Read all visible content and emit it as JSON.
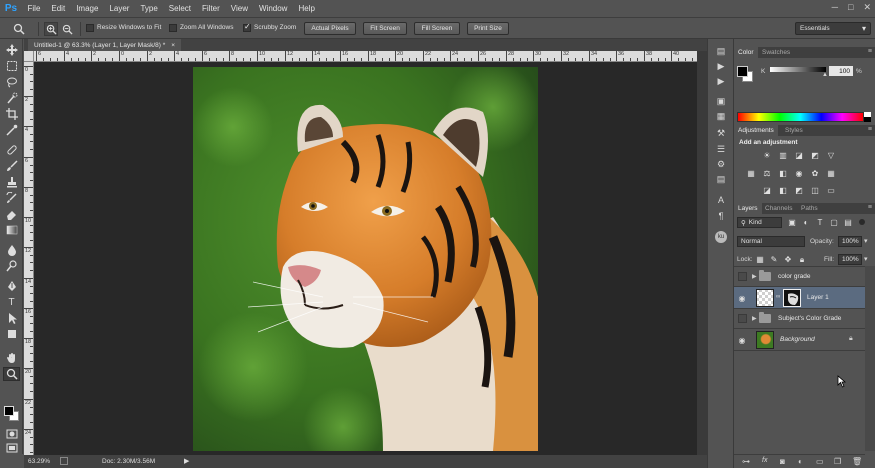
{
  "app": {
    "logo": "Ps"
  },
  "menu": [
    "File",
    "Edit",
    "Image",
    "Layer",
    "Type",
    "Select",
    "Filter",
    "View",
    "Window",
    "Help"
  ],
  "window_controls": [
    "─",
    "□",
    "✕"
  ],
  "options_bar": {
    "resize_windows_label": "Resize Windows to Fit",
    "zoom_all_label": "Zoom All Windows",
    "scrubby_zoom_label": "Scrubby Zoom",
    "actual_pixels_label": "Actual Pixels",
    "fit_screen_label": "Fit Screen",
    "fill_screen_label": "Fill Screen",
    "print_size_label": "Print Size",
    "workspace": "Essentials",
    "resize_checked": false,
    "zoom_all_checked": false,
    "scrubby_checked": true
  },
  "document": {
    "tab_title": "Untitled-1 @ 63.3% (Layer 1, Layer Mask/8) *",
    "tab_close": "×",
    "zoom": "63.29%",
    "doc_info": "Doc: 2.30M/3.56M"
  },
  "ruler": {
    "h_labels": [
      "6",
      "4",
      "2",
      "0",
      "2",
      "4",
      "6",
      "8",
      "10",
      "12",
      "14",
      "16",
      "18",
      "20",
      "22",
      "24",
      "26",
      "28",
      "30",
      "32",
      "34",
      "36",
      "38",
      "40"
    ],
    "v_labels": [
      "0",
      "2",
      "4",
      "6",
      "8",
      "10",
      "12",
      "14",
      "16",
      "18",
      "20",
      "22",
      "24"
    ]
  },
  "panels": {
    "color": {
      "tabs": [
        "Color",
        "Swatches"
      ],
      "channel": "K",
      "value": "100",
      "unit": "%"
    },
    "adjustments": {
      "tabs": [
        "Adjustments",
        "Styles"
      ],
      "heading": "Add an adjustment"
    },
    "layers": {
      "tabs": [
        "Layers",
        "Channels",
        "Paths"
      ],
      "filter_kind": "Kind",
      "blend_mode": "Normal",
      "opacity_label": "Opacity:",
      "opacity": "100%",
      "lock_label": "Lock:",
      "fill_label": "Fill:",
      "fill": "100%",
      "items": [
        {
          "name": "color grade",
          "type": "group",
          "visible": false
        },
        {
          "name": "Layer 1",
          "type": "layer-mask",
          "visible": true,
          "selected": true
        },
        {
          "name": "Subject's Color Grade",
          "type": "group",
          "visible": false
        },
        {
          "name": "Background",
          "type": "background",
          "visible": true
        }
      ],
      "footer_icons": [
        "link-icon",
        "fx-icon",
        "mask-icon",
        "adjustment-icon",
        "folder-icon",
        "new-layer-icon",
        "trash-icon"
      ]
    }
  },
  "colors": {
    "chrome": "#535353",
    "canvas_bg": "#282828",
    "selection": "#5b6b80",
    "ps_blue": "#2fa3ff"
  }
}
